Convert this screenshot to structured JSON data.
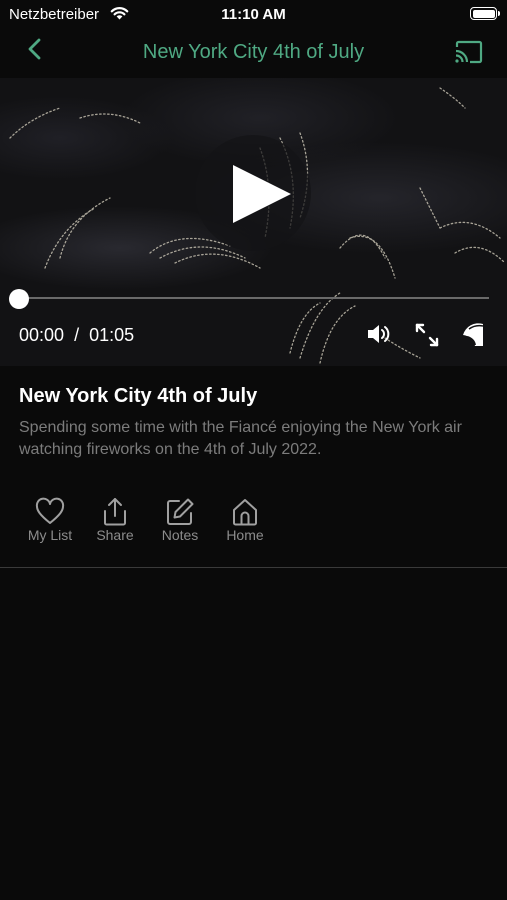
{
  "status_bar": {
    "carrier": "Netzbetreiber",
    "time": "11:10 AM",
    "battery_level": 1.0
  },
  "nav": {
    "title": "New York City 4th of July",
    "back_icon": "chevron-left-icon",
    "cast_icon": "cast-icon",
    "accent_color": "#4fa983"
  },
  "player": {
    "time_current": "00:00",
    "time_separator": "/",
    "time_total": "01:05",
    "progress": 0.0,
    "icons": [
      "play-icon",
      "volume-icon",
      "fullscreen-icon",
      "picture-in-picture-icon"
    ]
  },
  "video": {
    "title": "New York City 4th of July",
    "description": "Spending some time with the Fiancé enjoying the New York air watching fireworks on the 4th of July 2022."
  },
  "actions": [
    {
      "label": "My List",
      "icon": "heart-icon"
    },
    {
      "label": "Share",
      "icon": "share-icon"
    },
    {
      "label": "Notes",
      "icon": "edit-icon"
    },
    {
      "label": "Home",
      "icon": "home-icon"
    }
  ]
}
